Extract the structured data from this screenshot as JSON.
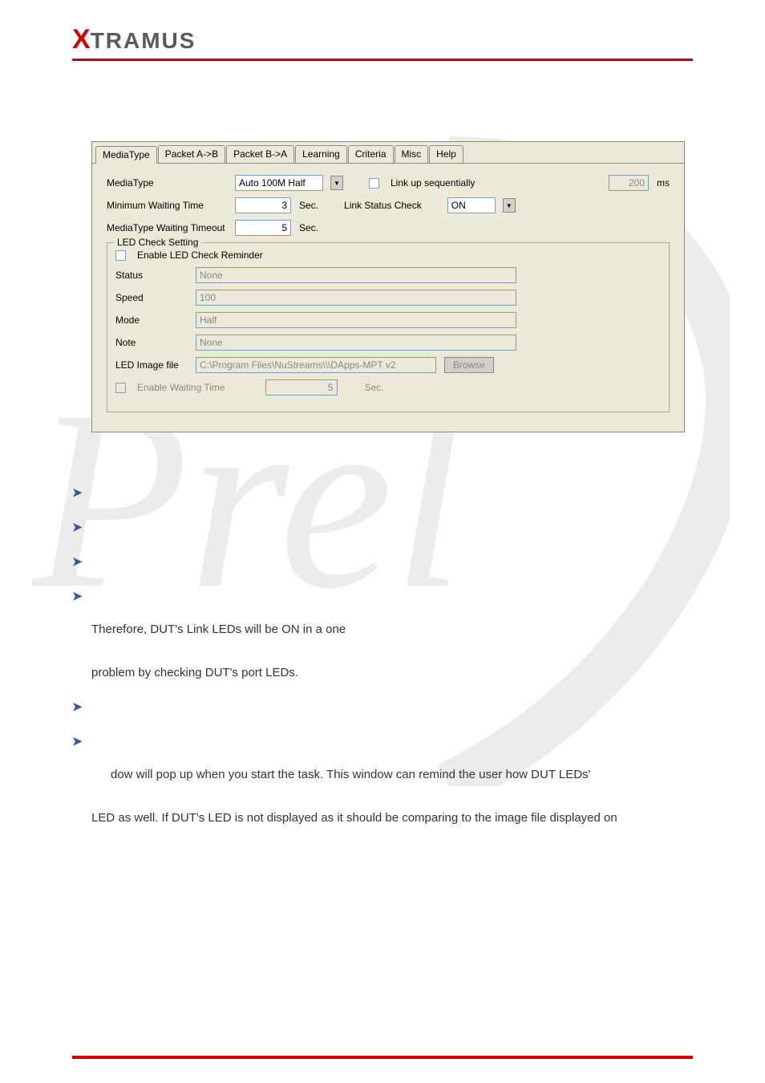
{
  "logo": {
    "x": "X",
    "rest": "TRAMUS"
  },
  "ui": {
    "tabs": [
      "MediaType",
      "Packet A->B",
      "Packet B->A",
      "Learning",
      "Criteria",
      "Misc",
      "Help"
    ],
    "activeTab": "MediaType",
    "mediaTypeLabel": "MediaType",
    "mediaTypeValue": "Auto 100M Half",
    "linkUpSeqLabel": "Link up sequentially",
    "linkUpSeqMs": "200",
    "msUnit": "ms",
    "minWaitLabel": "Minimum Waiting Time",
    "minWaitValue": "3",
    "secUnit": "Sec.",
    "linkStatusCheckLabel": "Link Status Check",
    "linkStatusCheckValue": "ON",
    "mtWaitTimeoutLabel": "MediaType Waiting Timeout",
    "mtWaitTimeoutValue": "5",
    "ledGroupTitle": "LED Check Setting",
    "enableLedReminderLabel": "Enable LED Check Reminder",
    "statusLabel": "Status",
    "statusValue": "None",
    "speedLabel": "Speed",
    "speedValue": "100",
    "modeLabel": "Mode",
    "modeValue": "Half",
    "noteLabel": "Note",
    "noteValue": "None",
    "ledImgLabel": "LED Image file",
    "ledImgValue": "C:\\Program Files\\NuStreams\\\\\\DApps-MPT v2",
    "browseLabel": "Browse",
    "enableWaitLabel": "Enable Waiting Time",
    "enableWaitValue": "5"
  },
  "doc": {
    "line1": "Therefore, DUT's Link LEDs will be ON in a one",
    "line2": "problem by checking DUT's port LEDs.",
    "line3": "dow will pop up when you start the task. This window can remind the user how DUT LEDs'",
    "line4": "LED as well. If DUT's LED is not displayed as it should be comparing to the image file displayed on"
  }
}
